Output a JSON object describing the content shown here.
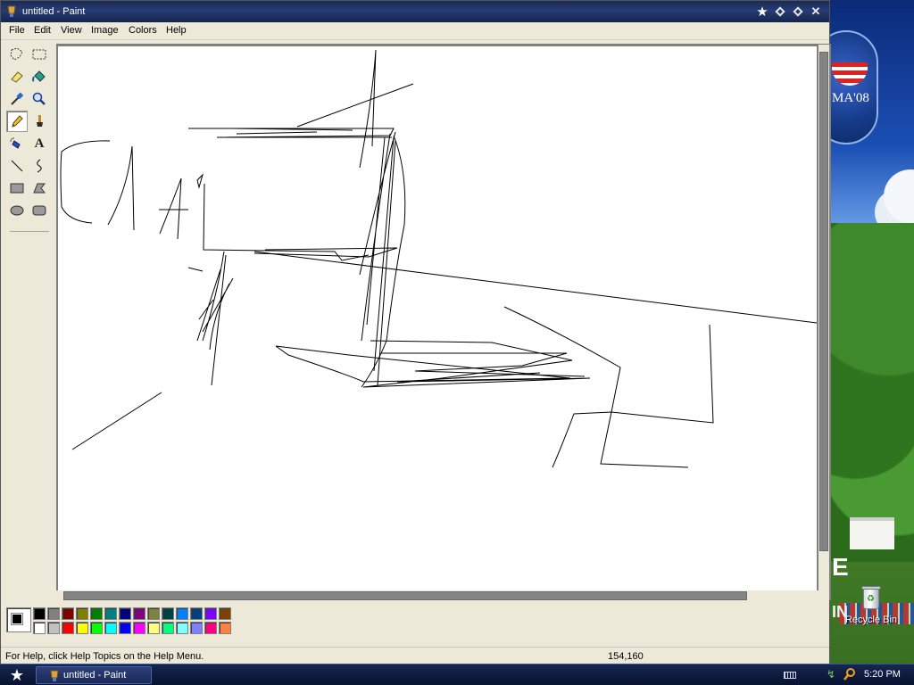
{
  "window": {
    "title": "untitled - Paint",
    "app_icon": "paint-icon"
  },
  "titlebar_buttons": [
    "star-icon",
    "minimize-icon",
    "maximize-icon",
    "close-icon"
  ],
  "menu": [
    "File",
    "Edit",
    "View",
    "Image",
    "Colors",
    "Help"
  ],
  "tools": [
    {
      "name": "free-form-select",
      "icon": "freeform-select-icon"
    },
    {
      "name": "select",
      "icon": "rect-select-icon"
    },
    {
      "name": "eraser",
      "icon": "eraser-icon"
    },
    {
      "name": "fill-with-color",
      "icon": "fill-bucket-icon"
    },
    {
      "name": "pick-color",
      "icon": "eyedropper-icon"
    },
    {
      "name": "magnifier",
      "icon": "magnifier-icon"
    },
    {
      "name": "pencil",
      "icon": "pencil-icon",
      "active": true
    },
    {
      "name": "brush",
      "icon": "brush-icon"
    },
    {
      "name": "airbrush",
      "icon": "airbrush-icon"
    },
    {
      "name": "text",
      "icon": "text-icon",
      "glyph": "A"
    },
    {
      "name": "line",
      "icon": "line-icon"
    },
    {
      "name": "curve",
      "icon": "curve-icon"
    },
    {
      "name": "rectangle",
      "icon": "rectangle-icon"
    },
    {
      "name": "polygon",
      "icon": "polygon-icon"
    },
    {
      "name": "ellipse",
      "icon": "ellipse-icon"
    },
    {
      "name": "rounded-rectangle",
      "icon": "rounded-rect-icon"
    }
  ],
  "palette": {
    "foreground": "#000000",
    "background": "#ffffff",
    "top_row": [
      "#000000",
      "#808080",
      "#800000",
      "#808000",
      "#008000",
      "#008080",
      "#000080",
      "#800080",
      "#808040",
      "#004040",
      "#0080ff",
      "#004080",
      "#8000ff",
      "#804000"
    ],
    "bottom_row": [
      "#ffffff",
      "#c0c0c0",
      "#ff0000",
      "#ffff00",
      "#00ff00",
      "#00ffff",
      "#0000ff",
      "#ff00ff",
      "#ffff80",
      "#00ff80",
      "#80ffff",
      "#8080ff",
      "#ff0080",
      "#ff8040"
    ]
  },
  "status": {
    "help": "For Help, click Help Topics on the Help Menu.",
    "coords": "154,160"
  },
  "desktop": {
    "icons": [
      {
        "label": "Recycle Bin",
        "icon": "recycle-bin-icon"
      }
    ],
    "wallpaper_text": "MA'08"
  },
  "taskbar": {
    "start_icon": "star-icon",
    "buttons": [
      {
        "label": "untitled - Paint",
        "icon": "paint-icon"
      }
    ],
    "tray": {
      "time": "5:20 PM",
      "icons": [
        "keyboard-icon",
        "network-icon",
        "search-icon"
      ]
    }
  },
  "colors": {
    "titlebar": "#1b2b56",
    "taskbar": "#0d1a3c",
    "window_face": "#ece9d8"
  }
}
